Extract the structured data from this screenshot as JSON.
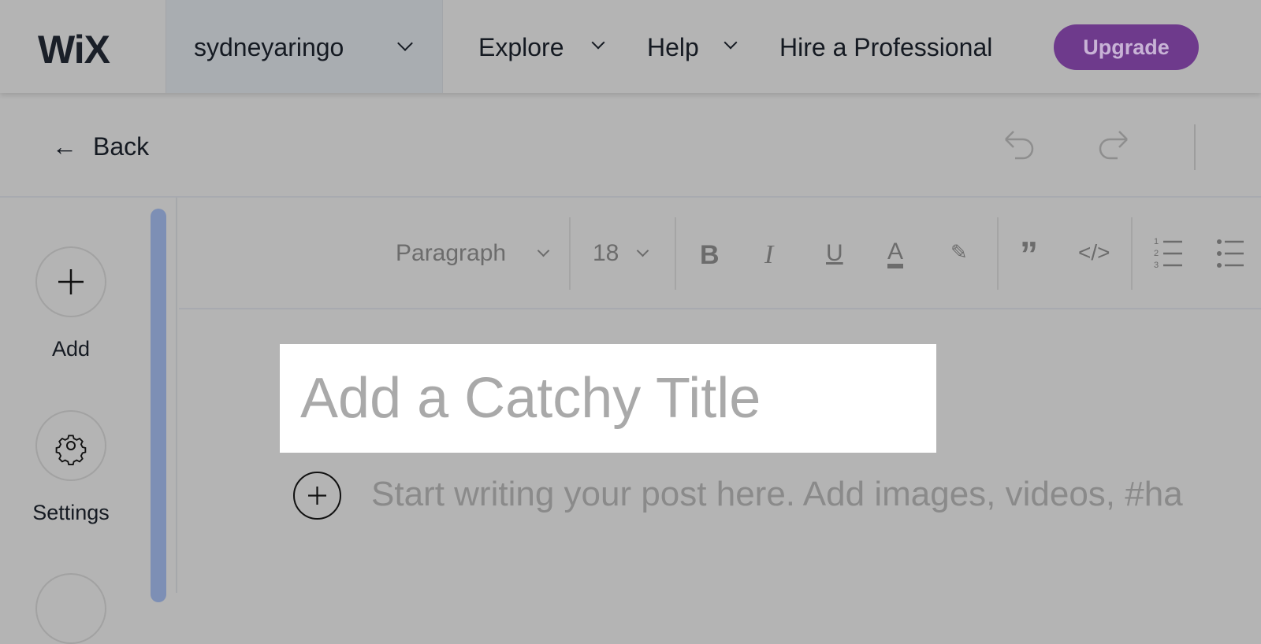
{
  "topbar": {
    "logo": "WiX",
    "site_name": "sydneyaringo",
    "nav": [
      "Explore",
      "Help",
      "Hire a Professional"
    ],
    "upgrade": "Upgrade",
    "upgrade_color": "#6e3a8c"
  },
  "backbar": {
    "back": "Back",
    "icons": [
      "undo-icon",
      "redo-icon"
    ]
  },
  "sidebar": {
    "items": [
      {
        "label": "Add",
        "icon": "plus-icon"
      },
      {
        "label": "Settings",
        "icon": "gear-icon"
      }
    ],
    "scrollbar_color": "#7d8fb5"
  },
  "toolbar": {
    "paragraph": "Paragraph",
    "font_size": "18",
    "buttons": [
      "bold",
      "italic",
      "underline",
      "text-color",
      "highlight",
      "quote",
      "code",
      "numbered-list",
      "bulleted-list"
    ]
  },
  "editor": {
    "title_placeholder": "Add a Catchy Title",
    "body_placeholder": "Start writing your post here. Add images, videos, #ha"
  }
}
